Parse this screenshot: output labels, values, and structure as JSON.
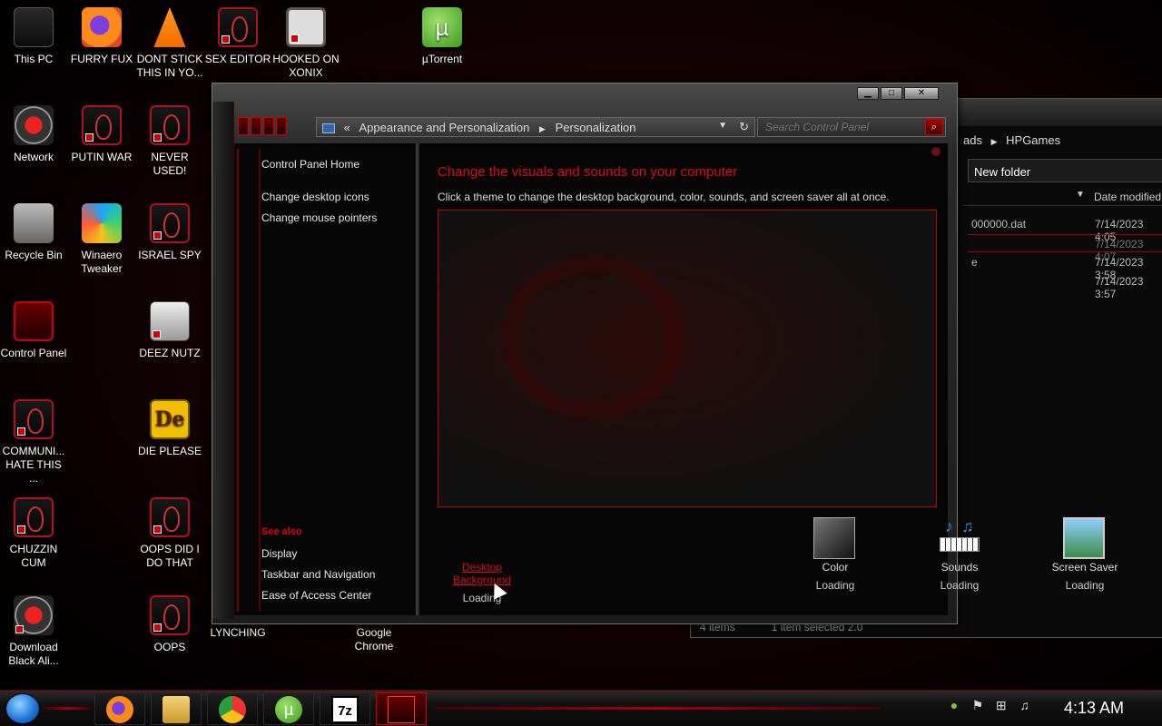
{
  "desktop": {
    "icons": [
      {
        "label": "This PC",
        "icon": "computer-icon"
      },
      {
        "label": "FURRY FUX",
        "icon": "firefox-icon"
      },
      {
        "label": "DONT STICK THIS IN YO...",
        "icon": "vlc-icon"
      },
      {
        "label": "SEX EDITOR",
        "icon": "alien-shortcut-icon"
      },
      {
        "label": "HOOKED ON XONIX",
        "icon": "game-icon"
      },
      {
        "label": "µTorrent",
        "icon": "utorrent-icon"
      },
      {
        "label": "Network",
        "icon": "network-icon"
      },
      {
        "label": "PUTIN WAR",
        "icon": "alien-shortcut-icon"
      },
      {
        "label": "NEVER USED!",
        "icon": "alien-shortcut-icon"
      },
      {
        "label": "Recycle Bin",
        "icon": "recycle-bin-icon"
      },
      {
        "label": "Winaero Tweaker",
        "icon": "winaero-icon"
      },
      {
        "label": "ISRAEL SPY",
        "icon": "alien-shortcut-icon"
      },
      {
        "label": "Control Panel",
        "icon": "control-panel-icon"
      },
      {
        "label": "DEEZ NUTZ",
        "icon": "stack-icon"
      },
      {
        "label": "COMMUNI... HATE THIS ...",
        "icon": "alien-shortcut-icon"
      },
      {
        "label": "DIE PLEASE",
        "icon": "die-icon"
      },
      {
        "label": "CHUZZIN CUM",
        "icon": "alien-shortcut-icon"
      },
      {
        "label": "OOPS DID I DO THAT",
        "icon": "alien-shortcut-icon"
      },
      {
        "label": "Download Black Ali...",
        "icon": "network-icon"
      },
      {
        "label": "OOPS",
        "icon": "alien-shortcut-icon"
      },
      {
        "label": "LYNCHING",
        "icon": "flag-icon"
      },
      {
        "label": "Google Chrome",
        "icon": "chrome-icon"
      }
    ]
  },
  "explorer": {
    "breadcrumb": [
      "ads",
      "HPGames"
    ],
    "folder_name": "New folder",
    "column": "Date modified",
    "rows": [
      {
        "name": "000000.dat",
        "date": "7/14/2023 4:05"
      },
      {
        "name": "",
        "date": "7/14/2023 4:07"
      },
      {
        "name": "e",
        "date": "7/14/2023 3:58"
      },
      {
        "name": "",
        "date": "7/14/2023 3:57"
      }
    ],
    "status_items": "4 items",
    "status_selected": "1 item selected  2.0"
  },
  "control_panel": {
    "address": {
      "back": "«",
      "crumb1": "Appearance and Personalization",
      "crumb2": "Personalization"
    },
    "search_placeholder": "Search Control Panel",
    "nav": {
      "home": "Control Panel Home",
      "desktop_icons": "Change desktop icons",
      "mouse_pointers": "Change mouse pointers",
      "see_also": "See also",
      "display": "Display",
      "taskbar": "Taskbar and Navigation",
      "ease": "Ease of Access Center"
    },
    "heading": "Change the visuals and sounds on your computer",
    "subheading": "Click a theme to change the desktop background, color, sounds, and screen saver all at once.",
    "bottom": {
      "background_label": "Desktop Background",
      "background_status": "Loading",
      "color_label": "Color",
      "color_status": "Loading",
      "sounds_label": "Sounds",
      "sounds_status": "Loading",
      "saver_label": "Screen Saver",
      "saver_status": "Loading"
    },
    "accent": "#d41010"
  },
  "taskbar": {
    "apps": [
      "firefox",
      "file-explorer",
      "chrome",
      "utorrent",
      "7-zip",
      "control-panel"
    ],
    "zip_glyph": "7z",
    "utorrent_glyph": "µ",
    "clock": "4:13 AM"
  }
}
